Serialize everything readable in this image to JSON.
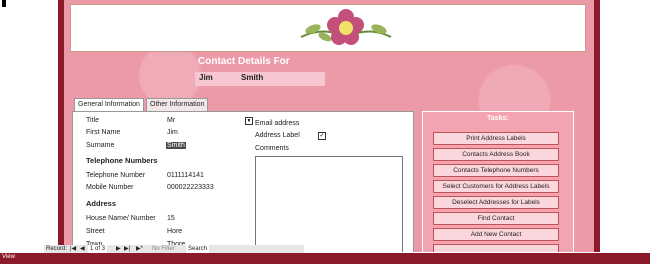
{
  "form": {
    "title": "Contact Details For",
    "first_name": "Jim",
    "last_name": "Smith"
  },
  "tabs": [
    "General Information",
    "Other Information"
  ],
  "general": {
    "title_label": "Title",
    "title_value": "Mr",
    "first_name_label": "First Name",
    "first_name_value": "Jim",
    "surname_label": "Surname",
    "surname_value": "Smith",
    "telephone_section": "Telephone Numbers",
    "telephone_label": "Telephone Number",
    "telephone_value": "0111114141",
    "mobile_label": "Mobile Number",
    "mobile_value": "000022223333",
    "address_section": "Address",
    "house_label": "House Name/ Number",
    "house_value": "15",
    "street_label": "Street",
    "street_value": "Hore",
    "town_label": "Town",
    "town_value": "Thore",
    "email_label": "Email address",
    "address_label_label": "Address Label",
    "address_label_checked": true,
    "comments_label": "Comments"
  },
  "tasks": {
    "header": "Tasks:",
    "buttons": [
      "Print Address Labels",
      "Contacts Address Book",
      "Contacts Telephone Numbers",
      "Select Customers for Address Labels",
      "Deselect Addresses for Labels",
      "Find Contact",
      "Add New Contact"
    ]
  },
  "record_nav": {
    "record_label": "Record:",
    "position": "1 of 3",
    "filter": "No Filter",
    "search": "Search"
  },
  "status": {
    "view": "View"
  },
  "colors": {
    "form_bg": "#ec9aa7",
    "dark_edge": "#8b1a2a",
    "button_bg": "#fbd7dd"
  }
}
